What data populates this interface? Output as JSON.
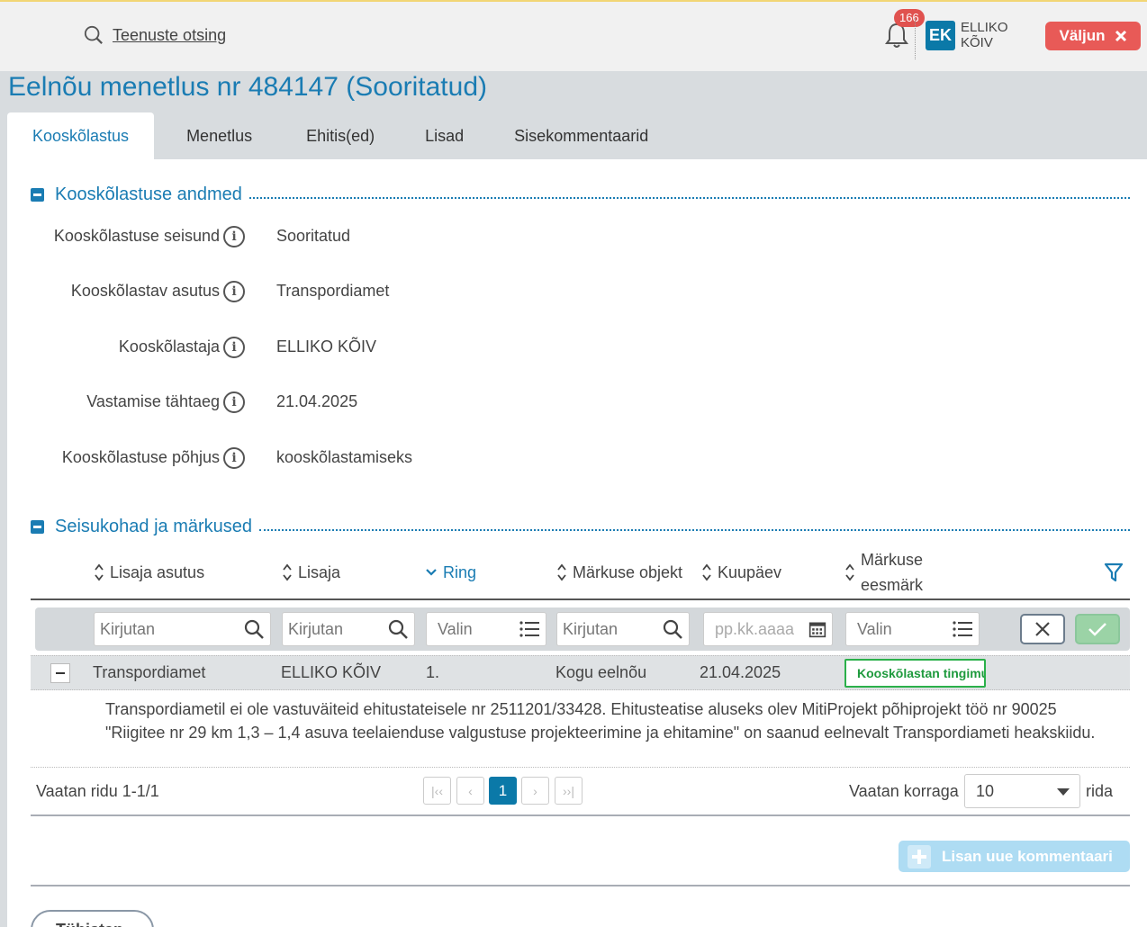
{
  "header": {
    "search_link": "Teenuste otsing",
    "notification_count": "166",
    "avatar_initials": "EK",
    "user_name": "ELLIKO KÕIV",
    "logout_label": "Väljun"
  },
  "page": {
    "title": "Eelnõu menetlus nr 484147 (Sooritatud)"
  },
  "tabs": [
    {
      "label": "Kooskõlastus",
      "active": true
    },
    {
      "label": "Menetlus"
    },
    {
      "label": "Ehitis(ed)"
    },
    {
      "label": "Lisad"
    },
    {
      "label": "Sisekommentaarid"
    }
  ],
  "details": {
    "section_title": "Kooskõlastuse andmed",
    "fields": [
      {
        "label": "Kooskõlastuse seisund",
        "value": "Sooritatud"
      },
      {
        "label": "Kooskõlastav asutus",
        "value": "Transpordiamet"
      },
      {
        "label": "Kooskõlastaja",
        "value": "ELLIKO KÕIV"
      },
      {
        "label": "Vastamise tähtaeg",
        "value": "21.04.2025"
      },
      {
        "label": "Kooskõlastuse põhjus",
        "value": "kooskõlastamiseks"
      }
    ]
  },
  "remarks": {
    "section_title": "Seisukohad ja märkused",
    "columns": [
      "Lisaja asutus",
      "Lisaja",
      "Ring",
      "Märkuse objekt",
      "Kuupäev",
      "Märkuse eesmärk"
    ],
    "filters": {
      "asutus": "Kirjutan",
      "lisaja": "Kirjutan",
      "ring": "Valin",
      "objekt": "Kirjutan",
      "kuupaev": "pp.kk.aaaa",
      "eesmark": "Valin"
    },
    "row": {
      "asutus": "Transpordiamet",
      "lisaja": "ELLIKO KÕIV",
      "ring": "1.",
      "objekt": "Kogu eelnõu",
      "kuupaev": "21.04.2025",
      "eesmark": "Kooskõlastan tingimustega"
    },
    "comment": "Transpordiametil ei ole vastuväiteid ehitustateisele nr 2511201/33428. Ehitusteatise aluseks olev MitiProjekt põhiprojekt töö nr 90025 \"Riigitee nr 29 km 1,3 – 1,4 asuva teelaienduse valgustuse projekteerimine ja ehitamine\" on saanud eelnevalt Transpordiameti heakskiidu.",
    "pager": {
      "info": "Vaatan ridu 1-1/1",
      "current_page": "1",
      "per_page_label": "Vaatan korraga",
      "per_page_value": "10",
      "rows_suffix": "rida"
    },
    "add_comment_label": "Lisan uue kommentaari"
  },
  "footer": {
    "back_label": "Tühistan"
  }
}
